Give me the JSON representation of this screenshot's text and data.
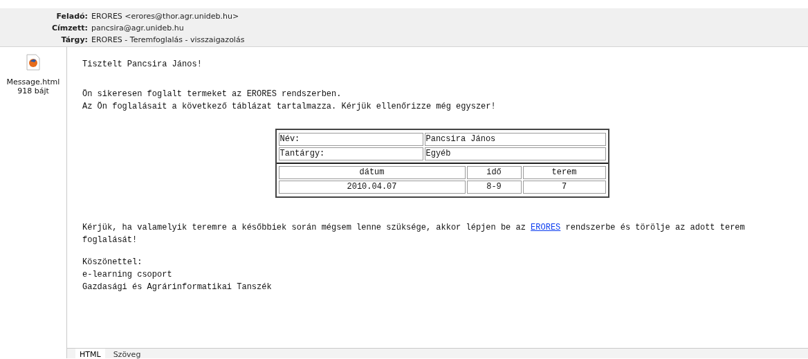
{
  "header": [
    {
      "label": "Feladó:",
      "value": "ERORES <erores@thor.agr.unideb.hu>"
    },
    {
      "label": "Címzett:",
      "value": "pancsira@agr.unideb.hu"
    },
    {
      "label": "Tárgy:",
      "value": "ERORES - Teremfoglalás - visszaigazolás"
    }
  ],
  "attachment": {
    "name": "Message.html",
    "size": "918 bájt"
  },
  "body": {
    "greeting": "Tisztelt Pancsira János!",
    "intro": [
      "Ön sikeresen foglalt termeket az ERORES rendszerben.",
      "Az Ön foglalásait a következő táblázat tartalmazza. Kérjük ellenőrizze még egyszer!"
    ],
    "info_rows": [
      {
        "label": "Név:",
        "value": "Pancsira János"
      },
      {
        "label": "Tantárgy:",
        "value": "Egyéb"
      }
    ],
    "booking_columns": [
      "dátum",
      "idő",
      "terem"
    ],
    "booking_rows": [
      [
        "2010.04.07",
        "8-9",
        "7"
      ]
    ],
    "notice": {
      "before": "Kérjük, ha valamelyik teremre a későbbiek során mégsem lenne szüksége, akkor lépjen be az ",
      "link": "ERORES",
      "after": " rendszerbe és törölje az adott terem foglalását!"
    },
    "signature": [
      "Köszönettel:",
      "e-learning csoport",
      "Gazdasági és Agrárinformatikai Tanszék"
    ]
  },
  "view_tabs": [
    {
      "label": "HTML",
      "selected": true
    },
    {
      "label": "Szöveg",
      "selected": false
    }
  ]
}
